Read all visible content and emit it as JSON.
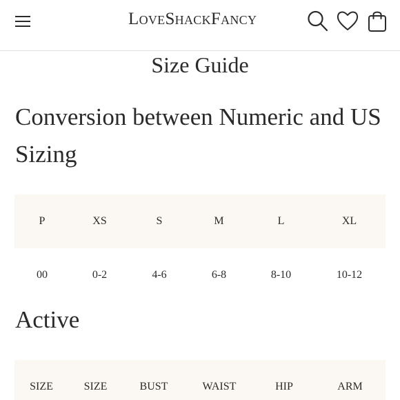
{
  "header": {
    "logo": "LoveShackFancy",
    "icons": [
      "menu-icon",
      "search-icon",
      "heart-icon",
      "shopping-bag-icon"
    ]
  },
  "page": {
    "title": "Size Guide"
  },
  "conversion": {
    "heading": "Conversion between Numeric and US Sizing",
    "headers": [
      "P",
      "XS",
      "S",
      "M",
      "L",
      "XL"
    ],
    "values": [
      "00",
      "0-2",
      "4-6",
      "6-8",
      "8-10",
      "10-12"
    ]
  },
  "active": {
    "heading": "Active",
    "headers": [
      "SIZE",
      "SIZE",
      "BUST",
      "WAIST",
      "HIP",
      "ARM"
    ]
  },
  "colors": {
    "text": "#2a2a2a",
    "table_header_bg": "#fbf8f3",
    "divider": "#e3e3e3"
  }
}
